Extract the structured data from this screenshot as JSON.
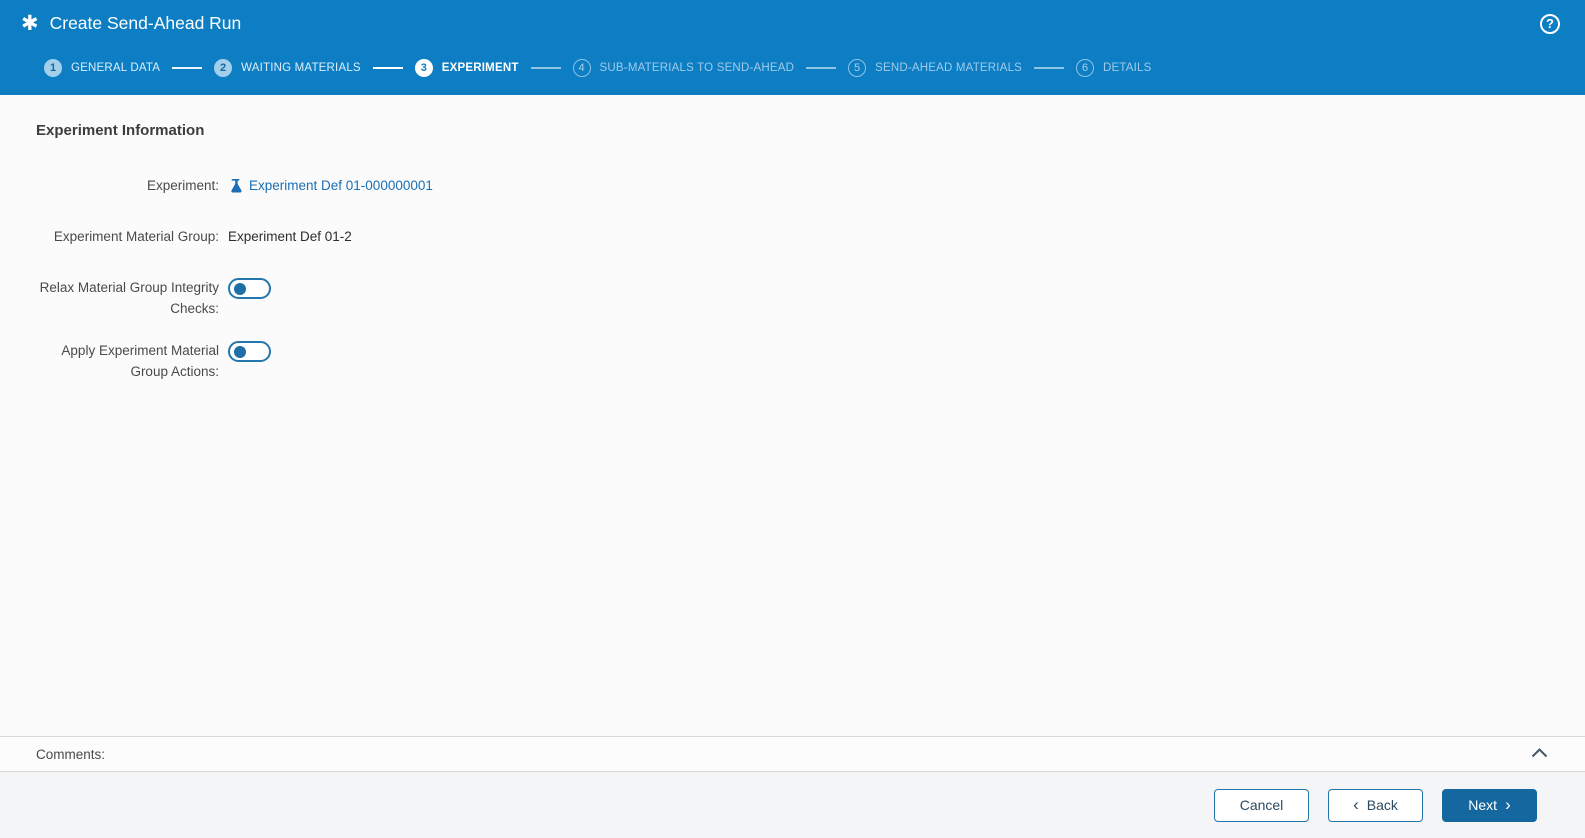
{
  "colors": {
    "header_bg": "#0d7ec3",
    "link": "#1a6fb5",
    "primary_button_bg": "#15689f",
    "button_border": "#2377ad",
    "toggle_knob": "#1d6fa5"
  },
  "header": {
    "title": "Create Send-Ahead Run",
    "app_icon_glyph": "✱",
    "help_icon_glyph": "?"
  },
  "stepper": {
    "steps": [
      {
        "number": "1",
        "label": "GENERAL DATA",
        "state": "completed"
      },
      {
        "number": "2",
        "label": "WAITING MATERIALS",
        "state": "completed"
      },
      {
        "number": "3",
        "label": "EXPERIMENT",
        "state": "active"
      },
      {
        "number": "4",
        "label": "SUB-MATERIALS TO SEND-AHEAD",
        "state": "upcoming"
      },
      {
        "number": "5",
        "label": "SEND-AHEAD MATERIALS",
        "state": "upcoming"
      },
      {
        "number": "6",
        "label": "DETAILS",
        "state": "upcoming"
      }
    ]
  },
  "main": {
    "section_heading": "Experiment Information",
    "fields": [
      {
        "label": "Experiment:",
        "type": "link",
        "icon": "flask-icon",
        "value": "Experiment Def 01-000000001"
      },
      {
        "label": "Experiment Material Group:",
        "type": "text",
        "value": "Experiment Def 01-2"
      },
      {
        "label": "Relax Material Group Integrity Checks:",
        "type": "toggle",
        "value": "off"
      },
      {
        "label": "Apply Experiment Material Group Actions:",
        "type": "toggle",
        "value": "off"
      }
    ]
  },
  "comments": {
    "label": "Comments:",
    "collapse_icon": "chevron-up"
  },
  "footer": {
    "cancel_label": "Cancel",
    "back_label": "Back",
    "next_label": "Next",
    "back_chevron_glyph": "‹",
    "next_chevron_glyph": "›"
  }
}
